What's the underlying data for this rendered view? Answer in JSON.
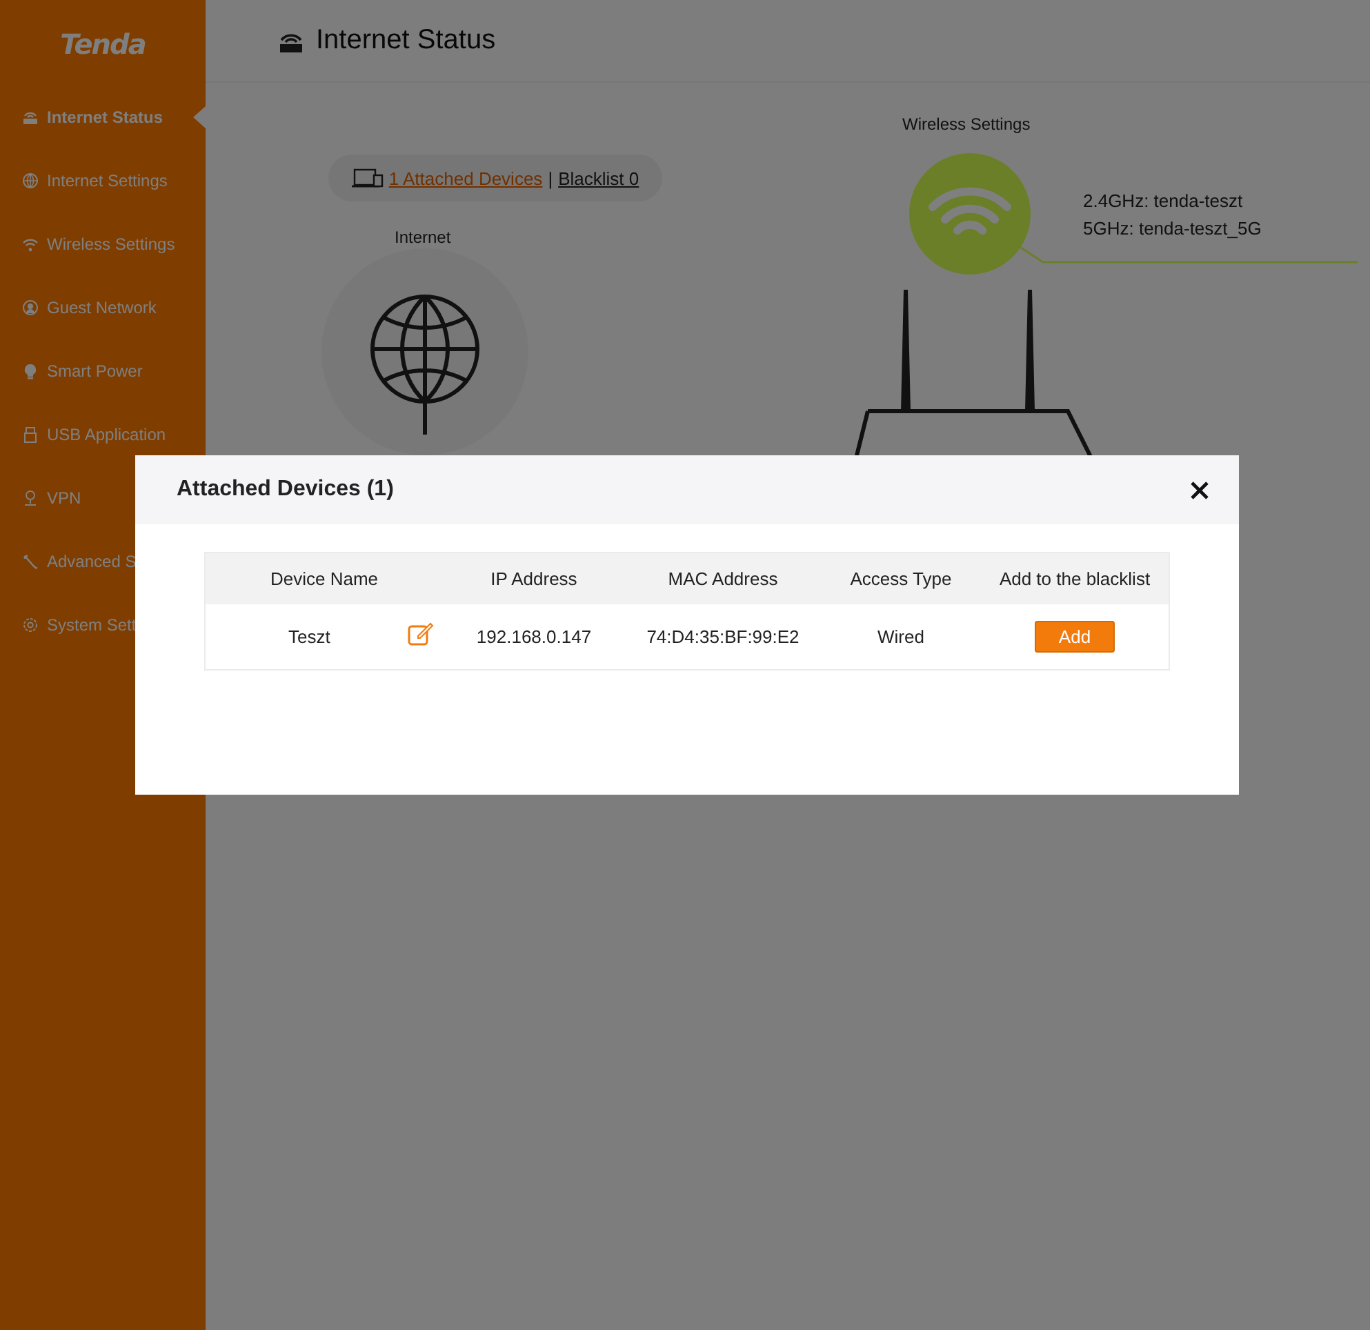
{
  "sidebar": {
    "logo": "Tenda",
    "items": [
      {
        "label": "Internet Status",
        "selected": true
      },
      {
        "label": "Internet Settings",
        "selected": false
      },
      {
        "label": "Wireless Settings",
        "selected": false
      },
      {
        "label": "Guest Network",
        "selected": false
      },
      {
        "label": "Smart Power",
        "selected": false
      },
      {
        "label": "USB Application",
        "selected": false
      },
      {
        "label": "VPN",
        "selected": false
      },
      {
        "label": "Advanced S",
        "selected": false
      },
      {
        "label": "System Sett",
        "selected": false
      }
    ]
  },
  "header": {
    "title": "Internet Status"
  },
  "status": {
    "attached_link": "1 Attached Devices",
    "separator": "|",
    "blacklist_link": "Blacklist 0",
    "internet_label": "Internet",
    "wireless_label": "Wireless Settings",
    "ssids": [
      "2.4GHz: tenda-teszt",
      "5GHz: tenda-teszt_5G"
    ]
  },
  "dialog": {
    "title": "Attached Devices (1)",
    "columns": [
      "Device Name",
      "IP Address",
      "MAC Address",
      "Access Type",
      "Add to the blacklist"
    ],
    "rows": [
      {
        "device_name": "Teszt",
        "ip_address": "192.168.0.147",
        "mac_address": "74:D4:35:BF:99:E2",
        "access_type": "Wired",
        "action": "Add"
      }
    ]
  }
}
